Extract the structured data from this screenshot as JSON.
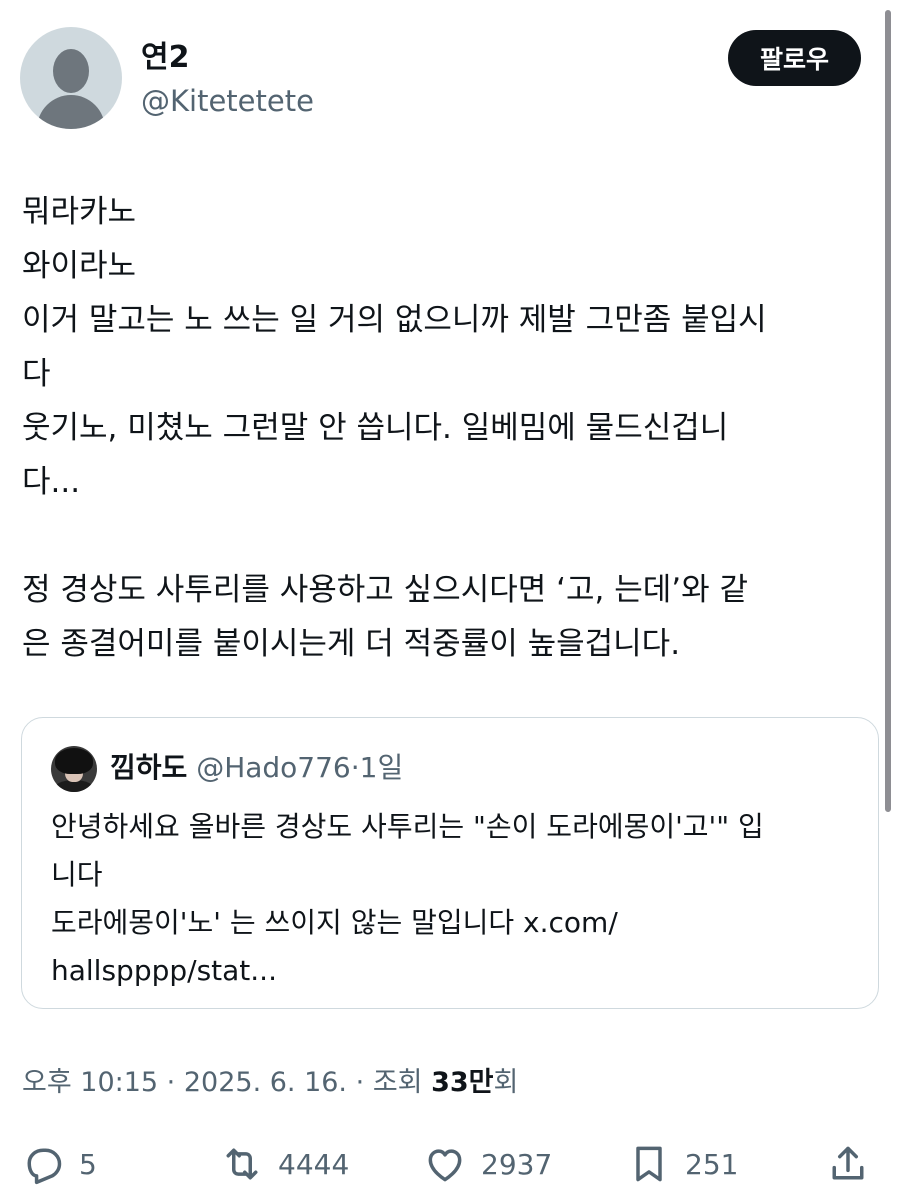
{
  "author": {
    "name": "연2",
    "handle": "@Kitetetete"
  },
  "follow_label": "팔로우",
  "tweet_lines": [
    "뭐라카노",
    "와이라노",
    "이거 말고는 노 쓰는 일 거의 없으니까 제발 그만좀 붙입시",
    "다",
    "웃기노, 미쳤노 그런말 안 씁니다. 일베밈에 물드신겁니",
    "다...",
    "",
    "정 경상도 사투리를 사용하고 싶으시다면 ‘고, 는데’와 같",
    "은 종결어미를 붙이시는게 더 적중률이 높을겁니다."
  ],
  "quote": {
    "name": "낌하도",
    "handle": "@Hado776",
    "separator": "·",
    "time": "1일",
    "lines": [
      "안녕하세요 올바른 경상도 사투리는 \"손이 도라에몽이'고'\" 입",
      "니다",
      "도라에몽이'노' 는 쓰이지 않는 말입니다 x.com/",
      "hallspppp/stat..."
    ]
  },
  "meta": {
    "time": "오후 10:15",
    "date": "2025. 6. 16.",
    "separator": "·",
    "views_label": "조회",
    "views_count": "33만",
    "views_suffix": "회"
  },
  "actions": {
    "reply_count": "5",
    "retweet_count": "4444",
    "like_count": "2937",
    "bookmark_count": "251"
  },
  "icons": [
    "person-placeholder-icon",
    "reply-icon",
    "retweet-icon",
    "like-icon",
    "bookmark-icon",
    "share-icon"
  ],
  "colors": {
    "text": "#0f1419",
    "secondary": "#536471",
    "border": "#cfd9de",
    "button_bg": "#0f1419"
  }
}
